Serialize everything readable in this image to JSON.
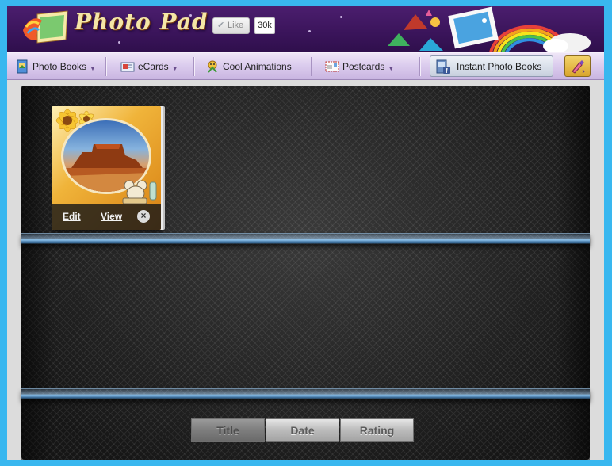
{
  "app": {
    "logo_text": "Photo Pad"
  },
  "like": {
    "label": "Like",
    "count": "30k"
  },
  "nav": {
    "items": [
      {
        "label": "Photo Books",
        "has_dropdown": true,
        "icon": "photo-book-icon"
      },
      {
        "label": "eCards",
        "has_dropdown": true,
        "icon": "ecard-icon"
      },
      {
        "label": "Cool Animations",
        "has_dropdown": false,
        "icon": "animation-icon"
      },
      {
        "label": "Postcards",
        "has_dropdown": true,
        "icon": "postcard-icon"
      }
    ],
    "instant_button": {
      "label": "Instant Photo Books",
      "icon": "facebook-book-icon"
    },
    "tool_button": {
      "icon": "paint-brush-icon"
    }
  },
  "album": {
    "edit_label": "Edit",
    "view_label": "View",
    "close_glyph": "×"
  },
  "sort": {
    "buttons": [
      {
        "label": "Title",
        "active": true
      },
      {
        "label": "Date",
        "active": false
      },
      {
        "label": "Rating",
        "active": false
      }
    ]
  },
  "colors": {
    "page_border": "#39b7ef",
    "header_purple": "#3a145a",
    "nav_lavender": "#dccdee"
  }
}
